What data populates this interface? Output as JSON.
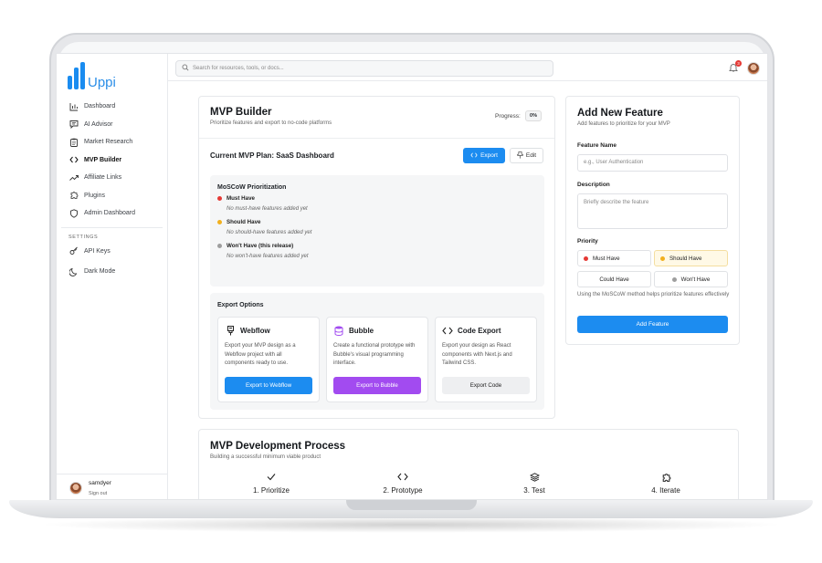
{
  "app": {
    "name": "Uppi"
  },
  "sidebar": {
    "items": [
      {
        "label": "Dashboard",
        "icon": "bar-chart-icon"
      },
      {
        "label": "AI Advisor",
        "icon": "chat-icon"
      },
      {
        "label": "Market Research",
        "icon": "clipboard-icon"
      },
      {
        "label": "MVP Builder",
        "icon": "code-icon",
        "active": true
      },
      {
        "label": "Affiliate Links",
        "icon": "trending-icon"
      },
      {
        "label": "Plugins",
        "icon": "puzzle-icon"
      },
      {
        "label": "Admin Dashboard",
        "icon": "shield-icon"
      }
    ],
    "settings_title": "SETTINGS",
    "settings": [
      {
        "label": "API Keys",
        "icon": "key-icon"
      },
      {
        "label": "Dark Mode",
        "icon": "moon-icon"
      }
    ],
    "user": {
      "name": "samdyer",
      "signout": "Sign out"
    }
  },
  "topbar": {
    "search_placeholder": "Search for resources, tools, or docs...",
    "notification_count": "3"
  },
  "builder": {
    "title": "MVP Builder",
    "subtitle": "Prioritize features and export to no-code platforms",
    "progress_label": "Progress:",
    "progress_value": "0%",
    "plan_title": "Current MVP Plan: SaaS Dashboard",
    "export_label": "Export",
    "edit_label": "Edit",
    "moscow": {
      "title": "MoSCoW Prioritization",
      "groups": [
        {
          "label": "Must Have",
          "empty": "No must-have features added yet",
          "color": "#e53935"
        },
        {
          "label": "Should Have",
          "empty": "No should-have features added yet",
          "color": "#f2b01e"
        },
        {
          "label": "Won't Have (this release)",
          "empty": "No won't-have features added yet",
          "color": "#9e9e9e"
        }
      ]
    },
    "export_options": {
      "title": "Export Options",
      "cards": [
        {
          "name": "Webflow",
          "desc": "Export your MVP design as a Webflow project with all components ready to use.",
          "button": "Export to Webflow",
          "color": "#1c8cf0"
        },
        {
          "name": "Bubble",
          "desc": "Create a functional prototype with Bubble's visual programming interface.",
          "button": "Export to Bubble",
          "color": "#a24bf0"
        },
        {
          "name": "Code Export",
          "desc": "Export your design as React components with Next.js and Tailwind CSS.",
          "button": "Export Code",
          "color": "#eeeff1"
        }
      ]
    }
  },
  "feature_form": {
    "title": "Add New Feature",
    "subtitle": "Add features to prioritize for your MVP",
    "name_label": "Feature Name",
    "name_placeholder": "e.g., User Authentication",
    "desc_label": "Description",
    "desc_placeholder": "Briefly describe the feature",
    "priority_label": "Priority",
    "priorities": [
      {
        "label": "Must Have",
        "color": "#e53935"
      },
      {
        "label": "Should Have",
        "color": "#f2b01e",
        "selected": true
      },
      {
        "label": "Could Have"
      },
      {
        "label": "Won't Have",
        "color": "#9e9e9e"
      }
    ],
    "help": "Using the MoSCoW method helps prioritize features effectively",
    "submit": "Add Feature"
  },
  "process": {
    "title": "MVP Development Process",
    "subtitle": "Building a successful minimum viable product",
    "steps": [
      {
        "label": "1. Prioritize",
        "icon": "check-icon"
      },
      {
        "label": "2. Prototype",
        "icon": "code-icon"
      },
      {
        "label": "3. Test",
        "icon": "layers-icon"
      },
      {
        "label": "4. Iterate",
        "icon": "puzzle-icon"
      }
    ]
  }
}
